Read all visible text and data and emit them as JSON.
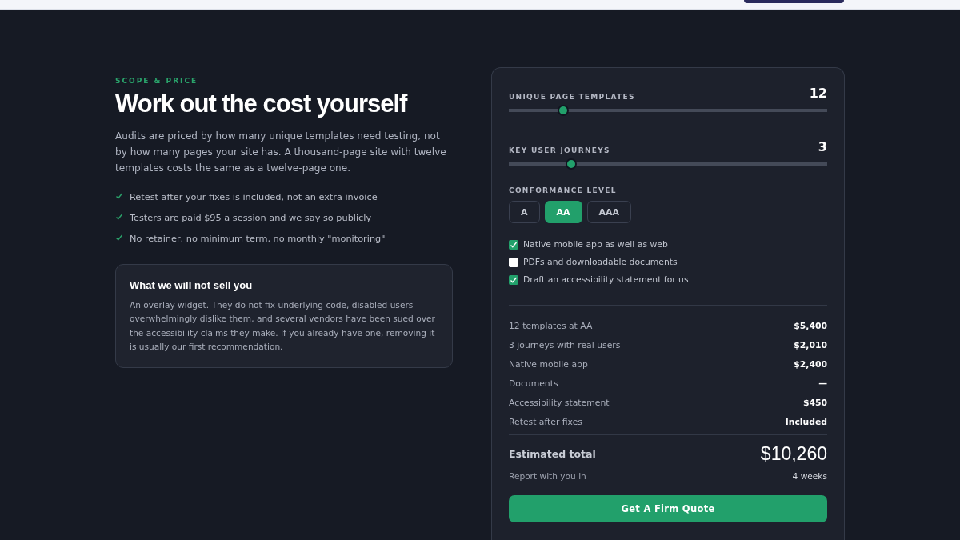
{
  "eyebrow": "SCOPE & PRICE",
  "heading": "Work out the cost yourself",
  "intro": "Audits are priced by how many unique templates need testing, not by how many pages your site has. A thousand-page site with twelve templates costs the same as a twelve-page one.",
  "points": [
    "Retest after your fixes is included, not an extra invoice",
    "Testers are paid $95 a session and we say so publicly",
    "No retainer, no minimum term, no monthly \"monitoring\""
  ],
  "note": {
    "title": "What we will not sell you",
    "body": "An overlay widget. They do not fix underlying code, disabled users overwhelmingly dislike them, and several vendors have been sued over the accessibility claims they make. If you already have one, removing it is usually our first recommendation."
  },
  "sliders": [
    {
      "label": "UNIQUE PAGE TEMPLATES",
      "value": "12",
      "level": 0.17
    },
    {
      "label": "KEY USER JOURNEYS",
      "value": "3",
      "level": 0.195
    }
  ],
  "conformance": {
    "label": "CONFORMANCE LEVEL",
    "options": [
      {
        "label": "A",
        "selected": false
      },
      {
        "label": "AA",
        "selected": true
      },
      {
        "label": "AAA",
        "selected": false
      }
    ]
  },
  "options": [
    {
      "label": "Native mobile app as well as web",
      "checked": true
    },
    {
      "label": "PDFs and downloadable documents",
      "checked": false
    },
    {
      "label": "Draft an accessibility statement for us",
      "checked": true
    }
  ],
  "lines": [
    {
      "label": "12 templates at AA",
      "amount": "$5,400"
    },
    {
      "label": "3 journeys with real users",
      "amount": "$2,010"
    },
    {
      "label": "Native mobile app",
      "amount": "$2,400"
    },
    {
      "label": "Documents",
      "amount": "—"
    },
    {
      "label": "Accessibility statement",
      "amount": "$450"
    },
    {
      "label": "Retest after fixes",
      "amount": "Included"
    }
  ],
  "total": {
    "label": "Estimated total",
    "amount": "$10,260"
  },
  "turnaround": {
    "label": "Report with you in",
    "value": "4 weeks"
  },
  "cta": "Get A Firm Quote"
}
